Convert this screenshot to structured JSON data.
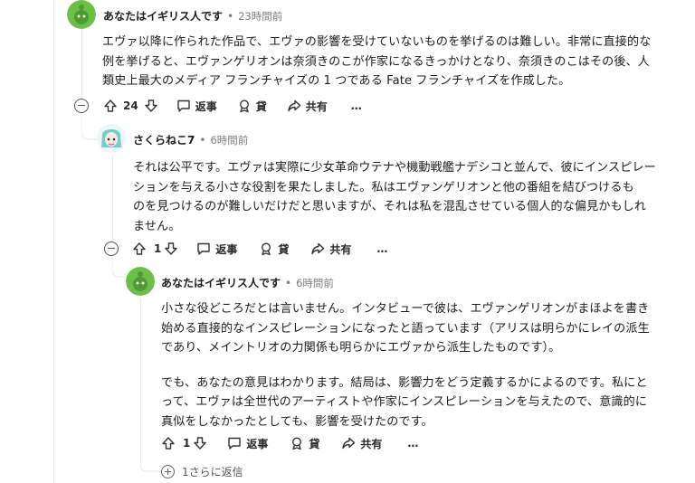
{
  "colors": {
    "avatar_green": "#6cc04a",
    "line": "#e5ebee",
    "muted": "#7c7c7c"
  },
  "comments": [
    {
      "author": "あなたはイギリス人です",
      "time": "23時間前",
      "avatar_icon": "snoo-green-avatar-icon",
      "lines": [
        "エヴァ以降に作られた作品で、エヴァの影響を受けていないものを挙げるのは難しい。非常に直接的な",
        "例を挙げると、エヴァンゲリオンは奈須きのこが作家になるきっかけとなり、奈須きのこはその後、人",
        "類史上最大のメディア フランチャイズの 1 つである Fate フランチャイズを作成した。"
      ],
      "votes": "24",
      "reply_label": "返事",
      "award_label": "貸",
      "share_label": "共有",
      "more_label": "…"
    },
    {
      "author": "さくらねこ7",
      "time": "6時間前",
      "avatar_icon": "custom-avatar-icon",
      "lines": [
        "それは公平です。エヴァは実際に少女革命ウテナや機動戦艦ナデシコと並んで、彼にインスピレー",
        "ションを与える小さな役割を果たしました。私はエヴァンゲリオンと他の番組を結びつけるも",
        "のを見つけるのが難しいだけだと思いますが、それは私を混乱させている個人的な偏見かもしれ",
        "ません。"
      ],
      "votes": "1",
      "reply_label": "返事",
      "award_label": "貸",
      "share_label": "共有",
      "more_label": "…"
    },
    {
      "author": "あなたはイギリス人です",
      "time": "6時間前",
      "avatar_icon": "snoo-green-avatar-icon",
      "paragraphs": [
        [
          "小さな役どころだとは言いません。インタビューで彼は、エヴァンゲリオンがまほよを書き",
          "始める直接的なインスピレーションになったと語っています（アリスは明らかにレイの派生",
          "であり、メイントリオの力関係も明らかにエヴァから派生したものです）。"
        ],
        [
          "でも、あなたの意見はわかります。結局は、影響力をどう定義するかによるのです。私にと",
          "って、エヴァは全世代のアーティストや作家にインスピレーションを与えたので、意識的に",
          "真似をしなかったとしても、影響を受けたのです。"
        ]
      ],
      "votes": "1",
      "reply_label": "返事",
      "award_label": "貸",
      "share_label": "共有",
      "more_label": "…"
    }
  ],
  "more_replies": "1さらに返信"
}
